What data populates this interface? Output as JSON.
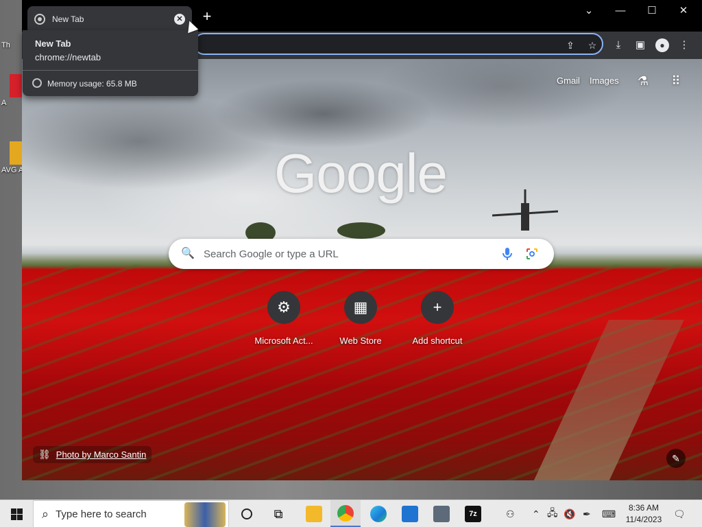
{
  "desktop": {
    "icons": [
      {
        "label": "Th"
      },
      {
        "label": "A"
      },
      {
        "label": "AVG A\nF"
      }
    ]
  },
  "tab": {
    "title": "New Tab",
    "close": "✕"
  },
  "new_tab_button": "+",
  "window_controls": {
    "dropdown": "⌄",
    "minimize": "—",
    "maximize": "☐",
    "close": "✕"
  },
  "hover_card": {
    "title": "New Tab",
    "url": "chrome://newtab",
    "memory": "Memory usage: 65.8 MB"
  },
  "ntp": {
    "links": {
      "gmail": "Gmail",
      "images": "Images"
    },
    "logo": "Google",
    "search_placeholder": "Search Google or type a URL",
    "shortcuts": [
      {
        "label": "Microsoft Act...",
        "glyph": "⚙"
      },
      {
        "label": "Web Store",
        "glyph": "▦"
      },
      {
        "label": "Add shortcut",
        "glyph": "+"
      }
    ],
    "attribution": "Photo by Marco Santin"
  },
  "taskbar": {
    "search_placeholder": "Type here to search",
    "time": "8:36 AM",
    "date": "11/4/2023"
  },
  "colors": {
    "focus_ring": "#8ab4f8",
    "tab_bg": "#35363a",
    "titlebar": "#000000"
  }
}
